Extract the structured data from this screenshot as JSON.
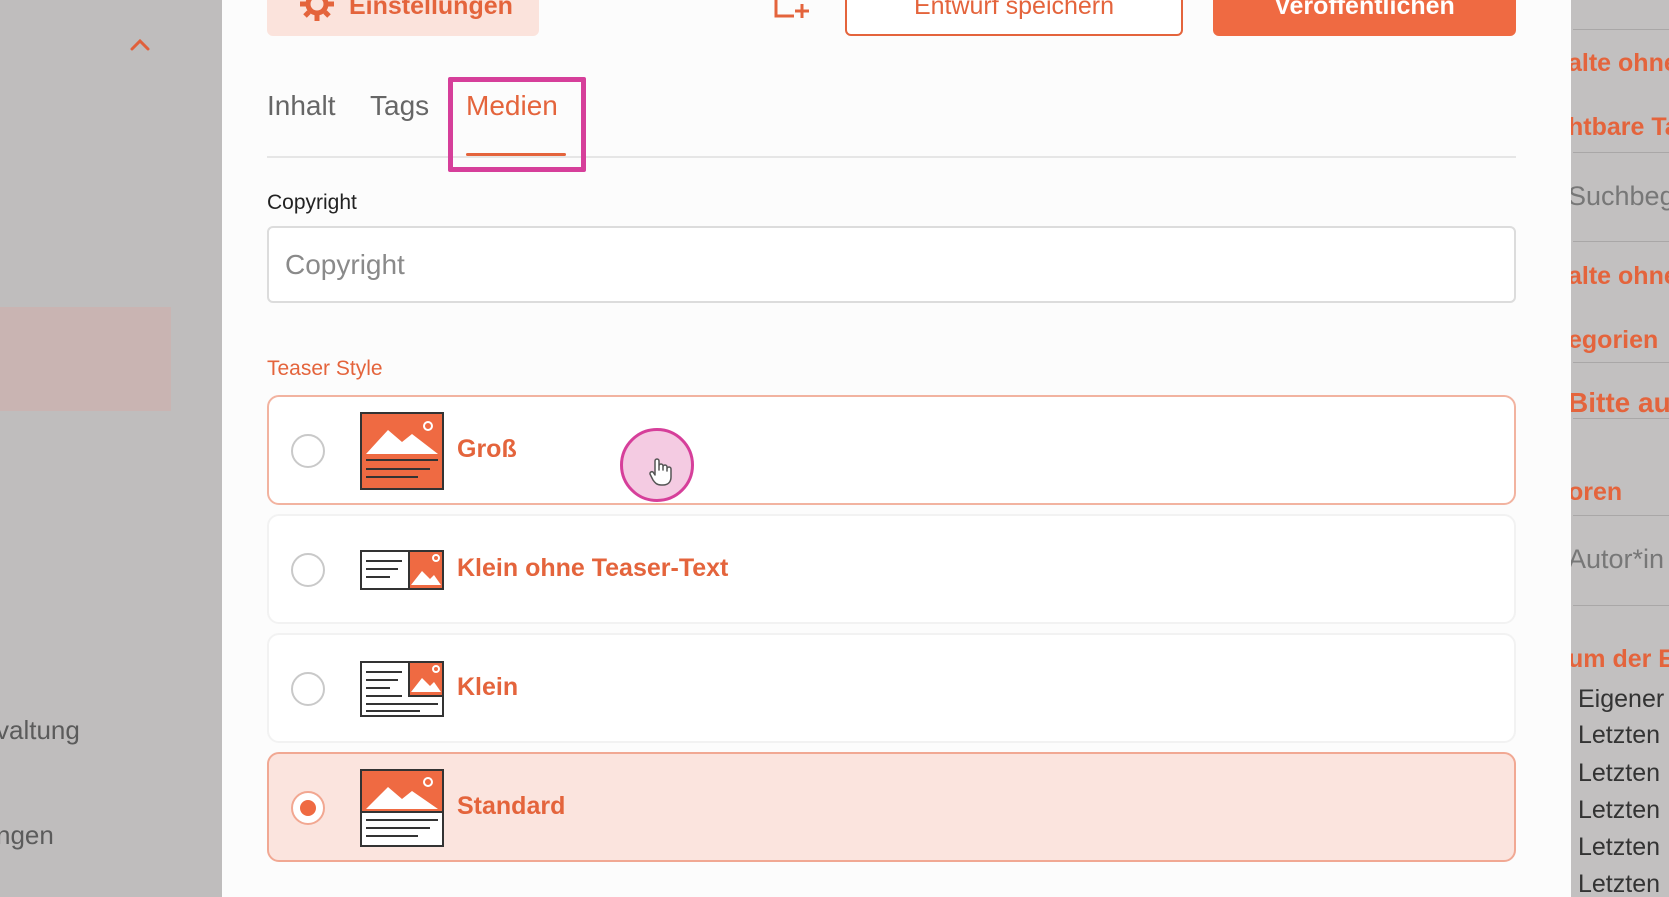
{
  "left_sidebar": {
    "items": [
      {
        "label": "valtung"
      },
      {
        "label": "ngen"
      }
    ]
  },
  "toolbar": {
    "settings_label": "Einstellungen",
    "draft_label": "Entwurf speichern",
    "publish_label": "Veröffentlichen"
  },
  "tabs": [
    {
      "label": "Inhalt",
      "active": false
    },
    {
      "label": "Tags",
      "active": false
    },
    {
      "label": "Medien",
      "active": true
    }
  ],
  "copyright": {
    "label": "Copyright",
    "placeholder": "Copyright",
    "value": ""
  },
  "teaser_style": {
    "label": "Teaser Style",
    "options": [
      {
        "label": "Groß",
        "selected": false,
        "icon": "teaser-large-icon"
      },
      {
        "label": "Klein ohne Teaser-Text",
        "selected": false,
        "icon": "teaser-small-no-text-icon"
      },
      {
        "label": "Klein",
        "selected": false,
        "icon": "teaser-small-icon"
      },
      {
        "label": "Standard",
        "selected": true,
        "icon": "teaser-standard-icon"
      }
    ]
  },
  "right_panel": {
    "items": [
      "alte ohne",
      "htbare Ta",
      "Suchbeg",
      "alte ohne",
      "egorien",
      "Bitte aus",
      "oren",
      "Autor*in",
      "um der E",
      "Eigener",
      "Letzten",
      "Letzten",
      "Letzten",
      "Letzten",
      "Letzten"
    ]
  },
  "colors": {
    "accent": "#e4643c",
    "highlight": "#d63f9a",
    "selected_bg": "#fbe4de"
  }
}
